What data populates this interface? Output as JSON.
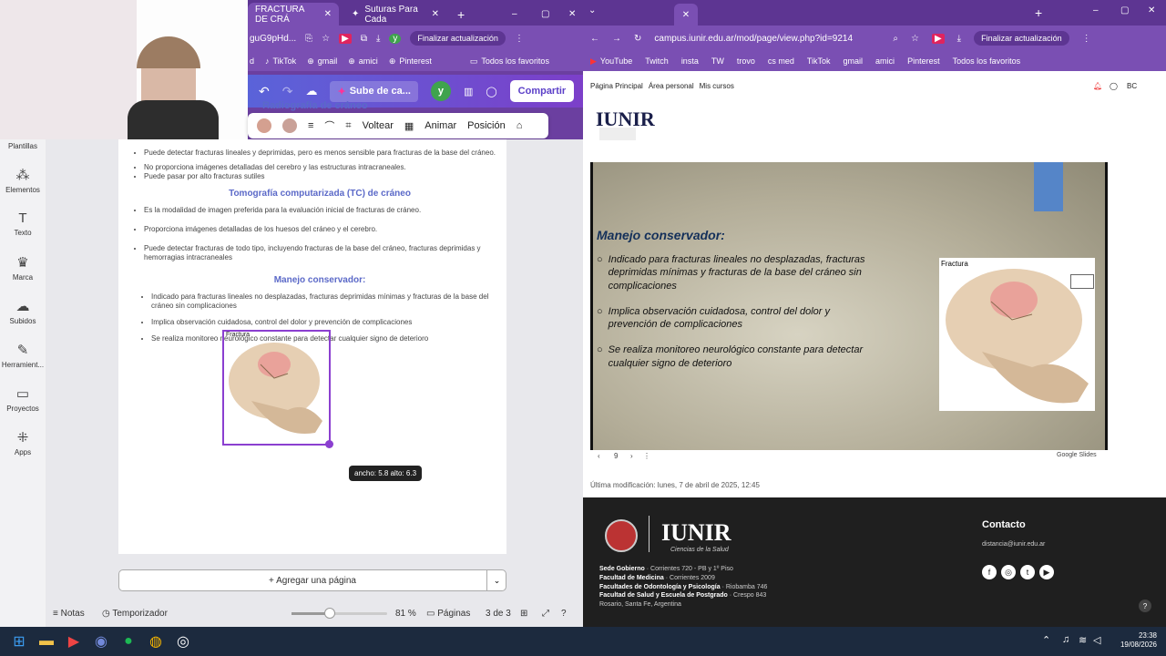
{
  "left_browser": {
    "tabs": [
      {
        "label": "FRACTURA DE CRÁ"
      },
      {
        "label": "Suturas Para Cada"
      }
    ],
    "address": "guG9pHd...",
    "update_button": "Finalizar actualización",
    "bookmarks": [
      "d",
      "TikTok",
      "gmail",
      "amici",
      "Pinterest",
      "Todos los favoritos"
    ]
  },
  "canva": {
    "toolbar": {
      "design_title": "Sube de ca...",
      "share": "Compartir",
      "avatar": "y"
    },
    "element_toolbar": {
      "flip": "Voltear",
      "animate": "Animar",
      "position": "Posición"
    },
    "partial_heading": "Radiografía de cráneo",
    "sidebar": [
      "Plantillas",
      "Elementos",
      "Texto",
      "Marca",
      "Subidos",
      "Herramient...",
      "Proyectos",
      "Apps"
    ],
    "doc": {
      "bullets_top": [
        "Puede detectar fracturas lineales y deprimidas, pero es menos sensible para fracturas de la base del cráneo.",
        "No proporciona imágenes detalladas del cerebro y las estructuras intracraneales.",
        "Puede pasar por alto fracturas sutiles"
      ],
      "tc_heading": "Tomografía computarizada (TC) de cráneo",
      "tc_bullets": [
        "Es la modalidad de imagen preferida para la evaluación inicial de fracturas de cráneo.",
        "Proporciona imágenes detalladas de los huesos del cráneo y el cerebro.",
        "Puede detectar fracturas de todo tipo, incluyendo fracturas de la base del cráneo, fracturas deprimidas y hemorragias intracraneales"
      ],
      "mc_heading": "Manejo conservador:",
      "mc_bullets": [
        "Indicado para fracturas lineales no desplazadas, fracturas deprimidas mínimas y fracturas de la base del cráneo sin complicaciones",
        "Implica observación cuidadosa, control del dolor y prevención de complicaciones",
        "Se realiza monitoreo neurológico constante para detectar cualquier signo de deterioro"
      ],
      "image_label": "Fractura"
    },
    "size_tooltip": "ancho: 5.8 alto: 6.3",
    "add_page": "+ Agregar una página",
    "bottom": {
      "notes": "Notas",
      "timer": "Temporizador",
      "zoom": "81 %",
      "zoom_level": 0.4,
      "pages_label": "Páginas",
      "pages": "3 de 3"
    }
  },
  "right_browser": {
    "address": "campus.iunir.edu.ar/mod/page/view.php?id=9214",
    "update_button": "Finalizar actualización",
    "bookmarks": [
      "YouTube",
      "Twitch",
      "insta",
      "TW",
      "trovo",
      "cs med",
      "TikTok",
      "gmail",
      "amici",
      "Pinterest",
      "Todos los favoritos"
    ]
  },
  "moodle": {
    "nav": [
      "Página Principal",
      "Área personal",
      "Mis cursos"
    ],
    "avatar": "BC",
    "logo": "IUNIR",
    "logo_sub": "Ciencias de la Salud",
    "slide": {
      "title": "Manejo conservador:",
      "bullets": [
        "Indicado para fracturas lineales no desplazadas, fracturas deprimidas mínimas y fracturas de la base del cráneo sin complicaciones",
        "Implica observación cuidadosa, control del dolor y prevención de complicaciones",
        "Se realiza monitoreo neurológico constante para detectar cualquier signo de deterioro"
      ],
      "image_label": "Fractura",
      "page": "9",
      "provider": "Google Slides"
    },
    "last_modified": "Última modificación: lunes, 7 de abril de 2025, 12:45",
    "footer": {
      "logo": "IUNIR",
      "logo_sub": "Ciencias de la Salud",
      "contact_title": "Contacto",
      "email": "distancia@iunir.edu.ar",
      "lines": [
        {
          "k": "Sede Gobierno",
          "v": "· Corrientes 720 - PB y 1º Piso"
        },
        {
          "k": "Facultad de Medicina",
          "v": "· Corrientes 2009"
        },
        {
          "k": "Facultades de Odontología y Psicología",
          "v": "· Riobamba 746"
        },
        {
          "k": "Facultad de Salud y Escuela de Postgrado",
          "v": "· Crespo 843"
        },
        {
          "k": "Rosario, Santa Fe, Argentina",
          "v": ""
        }
      ]
    }
  },
  "taskbar": {
    "time": "23:38",
    "date": "19/08/2026"
  }
}
